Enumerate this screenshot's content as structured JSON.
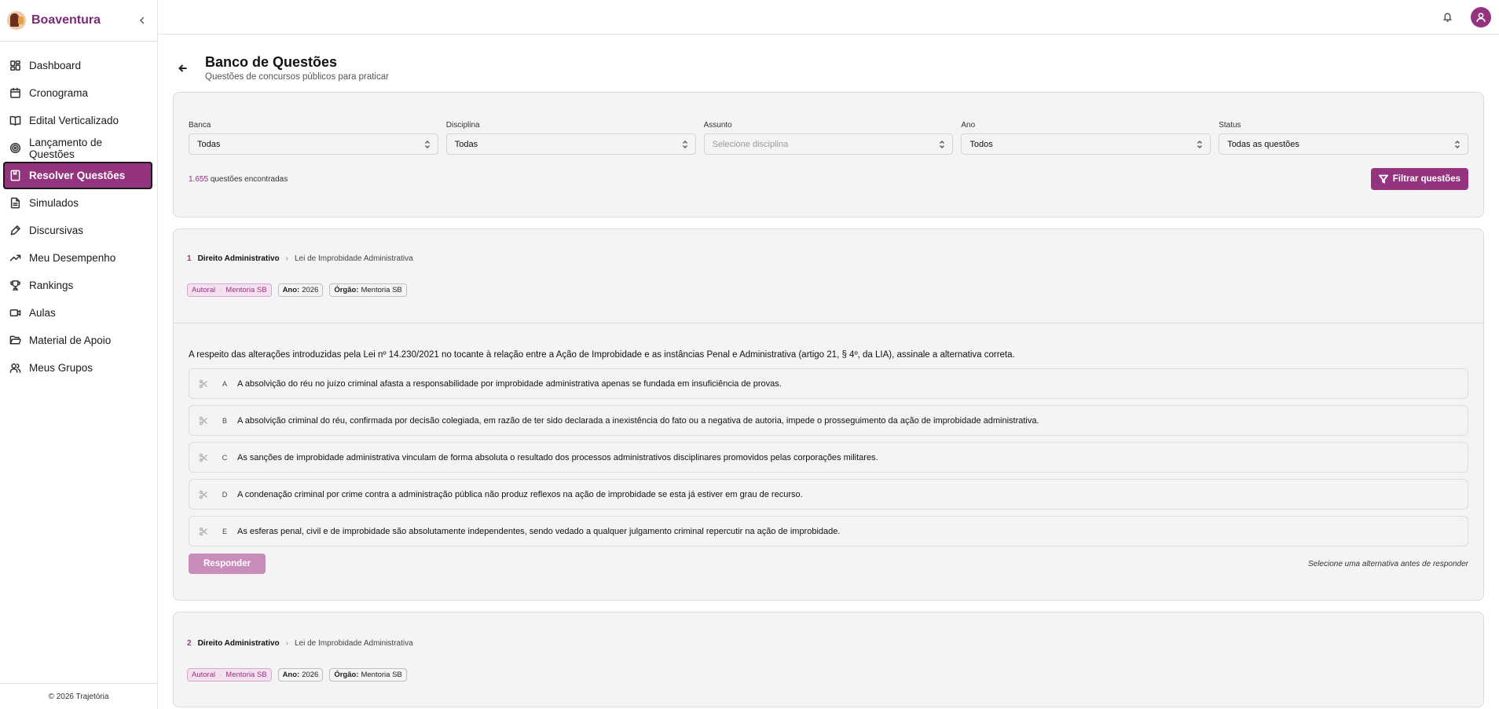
{
  "sidebar": {
    "brand": "Boaventura",
    "items": [
      {
        "label": "Dashboard",
        "icon": "dashboard-icon"
      },
      {
        "label": "Cronograma",
        "icon": "calendar-icon"
      },
      {
        "label": "Edital Verticalizado",
        "icon": "book-open-icon"
      },
      {
        "label": "Lançamento de Questões",
        "icon": "target-icon"
      },
      {
        "label": "Resolver Questões",
        "icon": "notebook-icon",
        "active": true
      },
      {
        "label": "Simulados",
        "icon": "file-text-icon"
      },
      {
        "label": "Discursivas",
        "icon": "pen-icon"
      },
      {
        "label": "Meu Desempenho",
        "icon": "trending-up-icon"
      },
      {
        "label": "Rankings",
        "icon": "trophy-icon"
      },
      {
        "label": "Aulas",
        "icon": "video-icon"
      },
      {
        "label": "Material de Apoio",
        "icon": "folder-open-icon"
      },
      {
        "label": "Meus Grupos",
        "icon": "users-icon"
      }
    ],
    "footer": "© 2026 Trajetória"
  },
  "header": {
    "title": "Banco de Questões",
    "subtitle": "Questões de concursos públicos para praticar"
  },
  "filters": {
    "banca": {
      "label": "Banca",
      "value": "Todas"
    },
    "disciplina": {
      "label": "Disciplina",
      "value": "Todas"
    },
    "assunto": {
      "label": "Assunto",
      "value": "Selecione disciplina"
    },
    "ano": {
      "label": "Ano",
      "value": "Todos"
    },
    "status": {
      "label": "Status",
      "value": "Todas as questões"
    },
    "count_number": "1.655",
    "count_text": "questões encontradas",
    "filter_button": "Filtrar questões"
  },
  "questions": [
    {
      "number": "1",
      "disciplina": "Direito Administrativo",
      "assunto": "Lei de Improbidade Administrativa",
      "tag_autoral": "Autoral",
      "tag_source": "Mentoria SB",
      "ano_label": "Ano:",
      "ano": "2026",
      "orgao_label": "Órgão:",
      "orgao": "Mentoria SB",
      "statement": "A respeito das alterações introduzidas pela Lei nº 14.230/2021 no tocante à relação entre a Ação de Improbidade e as instâncias Penal e Administrativa (artigo 21, § 4º, da LIA), assinale a alternativa correta.",
      "alternatives": [
        {
          "letter": "A",
          "text": "A absolvição do réu no juízo criminal afasta a responsabilidade por improbidade administrativa apenas se fundada em insuficiência de provas."
        },
        {
          "letter": "B",
          "text": "A absolvição criminal do réu, confirmada por decisão colegiada, em razão de ter sido declarada a inexistência do fato ou a negativa de autoria, impede o prosseguimento da ação de improbidade administrativa."
        },
        {
          "letter": "C",
          "text": "As sanções de improbidade administrativa vinculam de forma absoluta o resultado dos processos administrativos disciplinares promovidos pelas corporações militares."
        },
        {
          "letter": "D",
          "text": "A condenação criminal por crime contra a administração pública não produz reflexos na ação de improbidade se esta já estiver em grau de recurso."
        },
        {
          "letter": "E",
          "text": "As esferas penal, civil e de improbidade são absolutamente independentes, sendo vedado a qualquer julgamento criminal repercutir na ação de improbidade."
        }
      ],
      "answer_button": "Responder",
      "hint": "Selecione uma alternativa antes de responder"
    },
    {
      "number": "2",
      "disciplina": "Direito Administrativo",
      "assunto": "Lei de Improbidade Administrativa",
      "tag_autoral": "Autoral",
      "tag_source": "Mentoria SB",
      "ano_label": "Ano:",
      "ano": "2026",
      "orgao_label": "Órgão:",
      "orgao": "Mentoria SB"
    }
  ],
  "colors": {
    "accent": "#94347e",
    "accent_disabled": "#c98dbb"
  }
}
